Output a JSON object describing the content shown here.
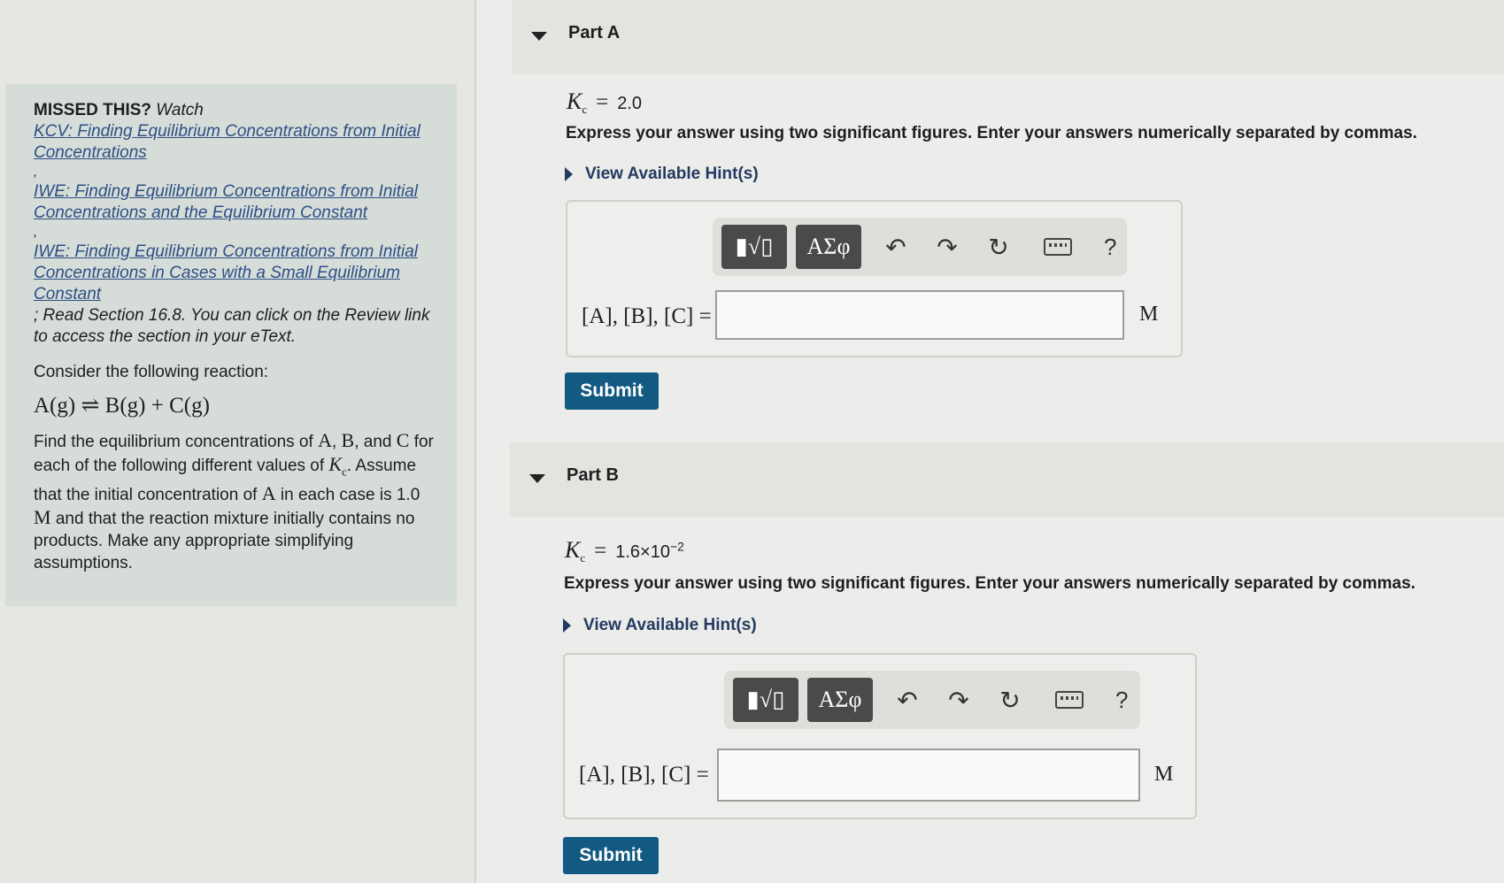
{
  "sidebar": {
    "missed": "MISSED THIS?",
    "watch": "Watch",
    "links": [
      "KCV: Finding Equilibrium Concentrations from Initial Concentrations",
      "IWE: Finding Equilibrium Concentrations from Initial Concentrations and the Equilibrium Constant",
      "IWE: Finding Equilibrium Concentrations from Initial Concentrations in Cases with a Small Equilibrium Constant"
    ],
    "comma": ",",
    "read_note": "; Read Section 16.8. You can click on the Review link to access the section in your eText.",
    "consider": "Consider the following reaction:",
    "reaction": "A(g) ⇌ B(g) + C(g)",
    "problem_1": "Find the equilibrium concentrations of ",
    "var_a": "A",
    "sep_1": ", ",
    "var_b": "B",
    "sep_2": ", and ",
    "var_c": "C",
    "problem_2": " for each of the following different values of ",
    "kc_symbol": "K",
    "kc_sub": "c",
    "problem_3": ". Assume that the initial concentration of ",
    "problem_4": " in each case is 1.0 ",
    "molar": "M",
    "problem_5": " and that the reaction mixture initially contains no products. Make any appropriate simplifying assumptions."
  },
  "parts": [
    {
      "title": "Part A",
      "kc_symbol": "K",
      "kc_sub": "c",
      "kc_eq": "=",
      "kc_value": "2.0",
      "kc_exp": "",
      "instruction": "Express your answer using two significant figures. Enter your answers numerically separated by commas.",
      "hint": "View Available Hint(s)",
      "toolbar": {
        "templates": "▮√▯",
        "greek": "ΑΣφ",
        "undo": "↶",
        "redo": "↷",
        "reset": "↻",
        "help": "?"
      },
      "label": "[A], [B], [C] =",
      "unit": "M",
      "input_value": "",
      "submit": "Submit"
    },
    {
      "title": "Part B",
      "kc_symbol": "K",
      "kc_sub": "c",
      "kc_eq": "=",
      "kc_value": "1.6×10",
      "kc_exp": "−2",
      "instruction": "Express your answer using two significant figures. Enter your answers numerically separated by commas.",
      "hint": "View Available Hint(s)",
      "toolbar": {
        "templates": "▮√▯",
        "greek": "ΑΣφ",
        "undo": "↶",
        "redo": "↷",
        "reset": "↻",
        "help": "?"
      },
      "label": "[A], [B], [C] =",
      "unit": "M",
      "input_value": "",
      "submit": "Submit"
    }
  ],
  "colors": {
    "submit": "#135a83",
    "link": "#2d4f86",
    "info_bg": "#d6ddd8"
  }
}
